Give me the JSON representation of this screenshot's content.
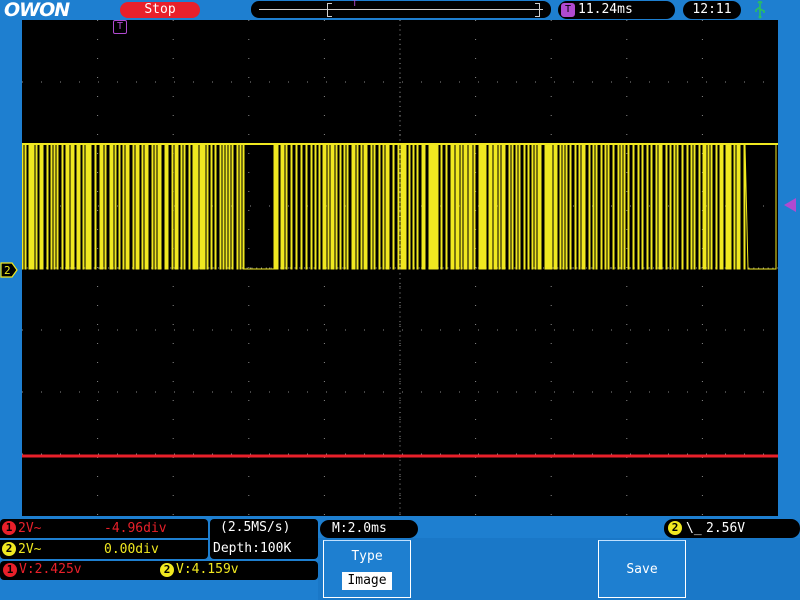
{
  "header": {
    "logo": "OWON",
    "run_status": "Stop",
    "trigger_time": "11.24ms",
    "trigger_badge": "T",
    "clock": "12:11",
    "usb_icon": "usb-icon"
  },
  "channels": [
    {
      "id": "1",
      "scale": "2V~",
      "position": "-4.96div",
      "color": "#e8202a"
    },
    {
      "id": "2",
      "scale": "2V~",
      "position": "0.00div",
      "color": "#f0e820"
    }
  ],
  "acquisition": {
    "sample_rate": "(2.5MS/s)",
    "depth": "Depth:100K"
  },
  "timebase": {
    "label": "M:2.0ms"
  },
  "trigger": {
    "source": "2",
    "edge": "\\_",
    "level": "2.56V",
    "marker": "T"
  },
  "measurements": [
    {
      "channel": "1",
      "text": "V:2.425v",
      "color": "#e8202a"
    },
    {
      "channel": "2",
      "text": "V:4.159v",
      "color": "#f0e820"
    }
  ],
  "menu": {
    "type_label": "Type",
    "type_value": "Image",
    "save_label": "Save"
  },
  "colors": {
    "frame": "#1e7fd0",
    "ch1": "#e8202a",
    "ch2": "#f0e820",
    "trigger": "#b04ad0"
  }
}
